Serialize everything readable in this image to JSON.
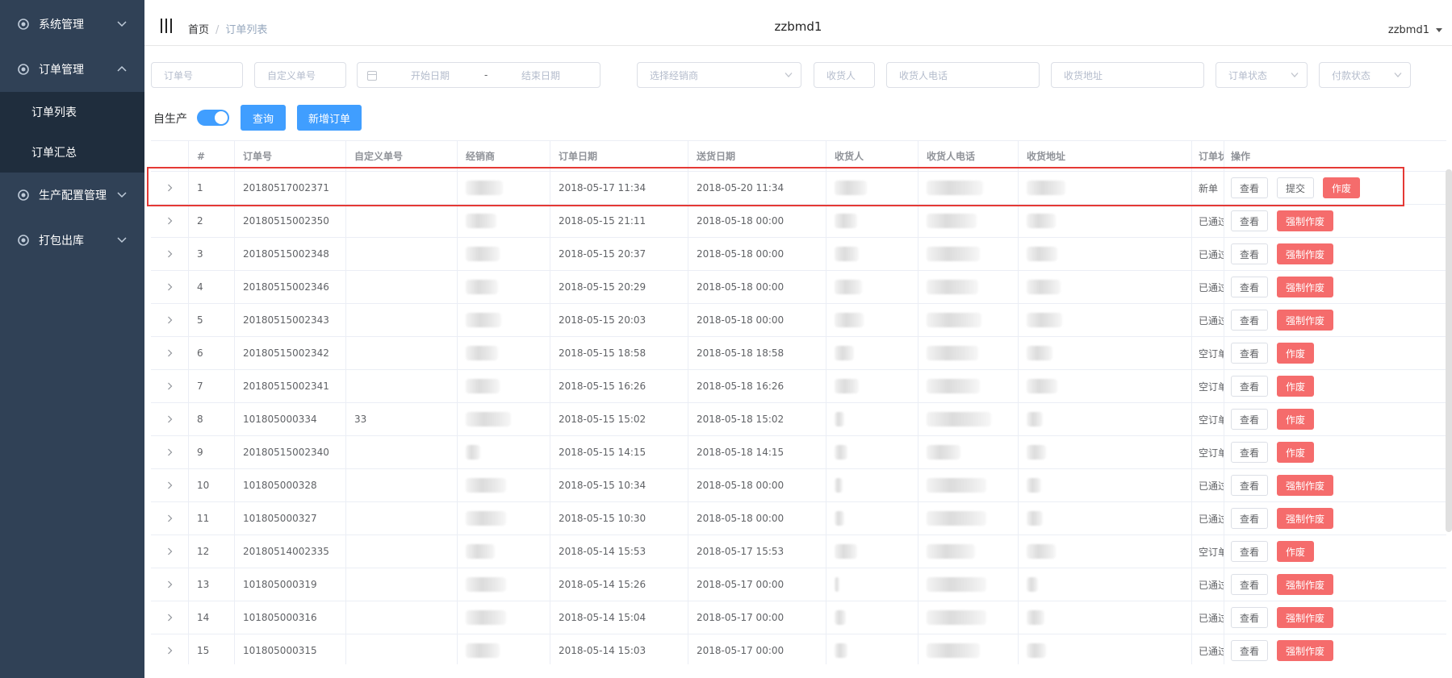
{
  "sidebar": {
    "menus": [
      {
        "label": "系统管理",
        "expanded": false,
        "items": []
      },
      {
        "label": "订单管理",
        "expanded": true,
        "items": [
          {
            "label": "订单列表"
          },
          {
            "label": "订单汇总"
          }
        ]
      },
      {
        "label": "生产配置管理",
        "expanded": false,
        "items": []
      },
      {
        "label": "打包出库",
        "expanded": false,
        "items": []
      }
    ]
  },
  "header": {
    "breadcrumb": {
      "home": "首页",
      "separator": "/",
      "current": "订单列表"
    },
    "title": "zzbmd1",
    "user": "zzbmd1"
  },
  "filters": {
    "order_no": "订单号",
    "custom_no": "自定义单号",
    "start_date": "开始日期",
    "date_sep": "-",
    "end_date": "结束日期",
    "dealer": "选择经销商",
    "receiver": "收货人",
    "receiver_phone": "收货人电话",
    "address": "收货地址",
    "order_status": "订单状态",
    "pay_status": "付款状态"
  },
  "toolbar": {
    "self_production_label": "自生产",
    "self_production_on": true,
    "query_label": "查询",
    "new_order_label": "新增订单"
  },
  "table": {
    "columns": [
      "#",
      "订单号",
      "自定义单号",
      "经销商",
      "订单日期",
      "送货日期",
      "收货人",
      "收货人电话",
      "收货地址",
      "订单状态",
      "操作"
    ],
    "rows": [
      {
        "idx": "1",
        "order_no": "20180517002371",
        "custom_no": "",
        "order_date": "2018-05-17 11:34",
        "delivery_date": "2018-05-20 11:34",
        "status": "新单",
        "actions": [
          "查看",
          "提交",
          "作废"
        ]
      },
      {
        "idx": "2",
        "order_no": "20180515002350",
        "custom_no": "",
        "order_date": "2018-05-15 21:11",
        "delivery_date": "2018-05-18 00:00",
        "status": "已通过",
        "actions": [
          "查看",
          "强制作废"
        ]
      },
      {
        "idx": "3",
        "order_no": "20180515002348",
        "custom_no": "",
        "order_date": "2018-05-15 20:37",
        "delivery_date": "2018-05-18 00:00",
        "status": "已通过",
        "actions": [
          "查看",
          "强制作废"
        ]
      },
      {
        "idx": "4",
        "order_no": "20180515002346",
        "custom_no": "",
        "order_date": "2018-05-15 20:29",
        "delivery_date": "2018-05-18 00:00",
        "status": "已通过",
        "actions": [
          "查看",
          "强制作废"
        ]
      },
      {
        "idx": "5",
        "order_no": "20180515002343",
        "custom_no": "",
        "order_date": "2018-05-15 20:03",
        "delivery_date": "2018-05-18 00:00",
        "status": "已通过",
        "actions": [
          "查看",
          "强制作废"
        ]
      },
      {
        "idx": "6",
        "order_no": "20180515002342",
        "custom_no": "",
        "order_date": "2018-05-15 18:58",
        "delivery_date": "2018-05-18 18:58",
        "status": "空订单",
        "actions": [
          "查看",
          "作废"
        ]
      },
      {
        "idx": "7",
        "order_no": "20180515002341",
        "custom_no": "",
        "order_date": "2018-05-15 16:26",
        "delivery_date": "2018-05-18 16:26",
        "status": "空订单",
        "actions": [
          "查看",
          "作废"
        ]
      },
      {
        "idx": "8",
        "order_no": "101805000334",
        "custom_no": "33",
        "order_date": "2018-05-15 15:02",
        "delivery_date": "2018-05-18 15:02",
        "status": "空订单",
        "actions": [
          "查看",
          "作废"
        ]
      },
      {
        "idx": "9",
        "order_no": "20180515002340",
        "custom_no": "",
        "order_date": "2018-05-15 14:15",
        "delivery_date": "2018-05-18 14:15",
        "status": "空订单",
        "actions": [
          "查看",
          "作废"
        ]
      },
      {
        "idx": "10",
        "order_no": "101805000328",
        "custom_no": "",
        "order_date": "2018-05-15 10:34",
        "delivery_date": "2018-05-18 00:00",
        "status": "已通过",
        "actions": [
          "查看",
          "强制作废"
        ]
      },
      {
        "idx": "11",
        "order_no": "101805000327",
        "custom_no": "",
        "order_date": "2018-05-15 10:30",
        "delivery_date": "2018-05-18 00:00",
        "status": "已通过",
        "actions": [
          "查看",
          "强制作废"
        ]
      },
      {
        "idx": "12",
        "order_no": "20180514002335",
        "custom_no": "",
        "order_date": "2018-05-14 15:53",
        "delivery_date": "2018-05-17 15:53",
        "status": "空订单",
        "actions": [
          "查看",
          "作废"
        ]
      },
      {
        "idx": "13",
        "order_no": "101805000319",
        "custom_no": "",
        "order_date": "2018-05-14 15:26",
        "delivery_date": "2018-05-17 00:00",
        "status": "已通过",
        "actions": [
          "查看",
          "强制作废"
        ]
      },
      {
        "idx": "14",
        "order_no": "101805000316",
        "custom_no": "",
        "order_date": "2018-05-14 15:04",
        "delivery_date": "2018-05-17 00:00",
        "status": "已通过",
        "actions": [
          "查看",
          "强制作废"
        ]
      },
      {
        "idx": "15",
        "order_no": "101805000315",
        "custom_no": "",
        "order_date": "2018-05-14 15:03",
        "delivery_date": "2018-05-17 00:00",
        "status": "已通过",
        "actions": [
          "查看",
          "强制作废"
        ]
      }
    ]
  },
  "colors": {
    "sidebar_bg": "#304156",
    "submenu_bg": "#1f2d3d",
    "primary": "#409eff",
    "danger": "#f56c6c",
    "highlight_border": "#e53935"
  },
  "icons": {
    "menu": "gear-icon",
    "expand": "chevron-down-icon",
    "collapse": "chevron-up-icon",
    "row_expand": "chevron-right-icon",
    "date": "calendar-icon"
  }
}
